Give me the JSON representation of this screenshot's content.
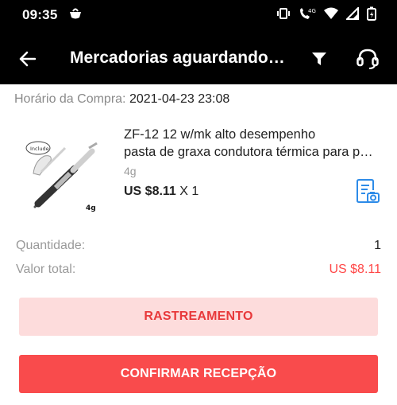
{
  "status_bar": {
    "time": "09:35",
    "network": "4G"
  },
  "app_bar": {
    "title": "Mercadorias aguardando…",
    "back_icon": "arrow-left-icon",
    "filter_icon": "filter-icon",
    "support_icon": "headset-icon"
  },
  "order": {
    "purchase_time_label": "Horário da Compra:",
    "purchase_time_value": "2021-04-23 23:08"
  },
  "product": {
    "title_line1": "ZF-12 12 w/mk alto desempenho",
    "title_line2": "pasta de graxa condutora térmica para p…",
    "variant": "4g",
    "price": "US $8.11",
    "quantity": "X 1",
    "thumb_badge": "Include",
    "thumb_weight": "4g"
  },
  "summary": {
    "quantity_label": "Quantidade:",
    "quantity_value": "1",
    "total_label": "Valor total:",
    "total_value": "US $8.11"
  },
  "actions": {
    "track_label": "RASTREAMENTO",
    "confirm_label": "CONFIRMAR RECEPÇÃO"
  },
  "colors": {
    "accent": "#f94b4c",
    "accent_light": "#fddcdc",
    "price_red": "#ff4747",
    "snapshot_blue": "#2d8be8"
  }
}
